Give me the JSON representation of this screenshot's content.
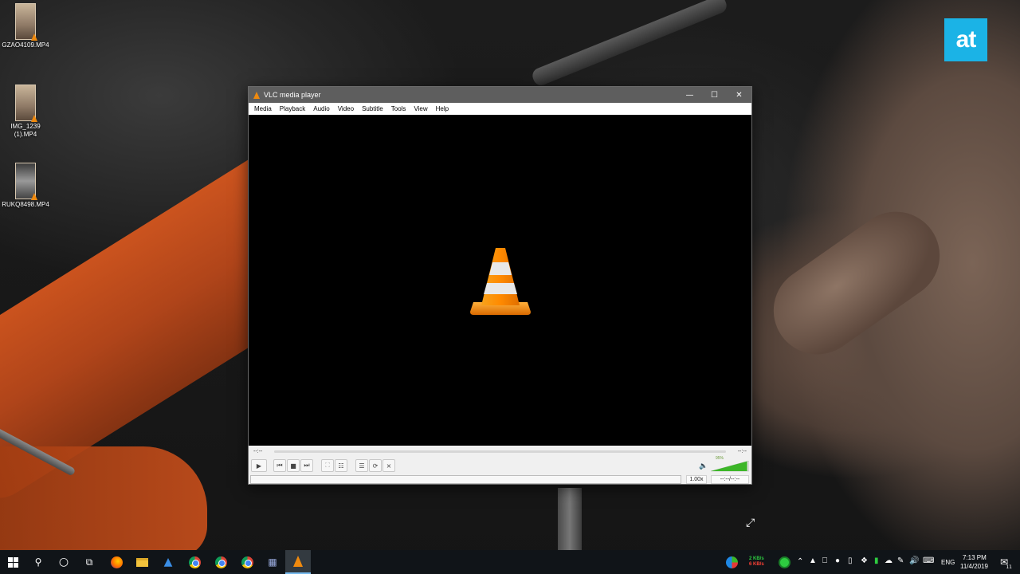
{
  "desktop": {
    "icons": [
      {
        "label": "GZAO4109.MP4"
      },
      {
        "label": "IMG_1239 (1).MP4"
      },
      {
        "label": "RUKQ8498.MP4"
      }
    ],
    "watermark": "at"
  },
  "vlc": {
    "title": "VLC media player",
    "menu": [
      "Media",
      "Playback",
      "Audio",
      "Video",
      "Subtitle",
      "Tools",
      "View",
      "Help"
    ],
    "elapsed": "--:--",
    "remaining": "--:--",
    "volume_percent": "95%",
    "volume_level": 0.95,
    "speed": "1.00x",
    "time_display": "--:--/--:--",
    "colors": {
      "cone_orange": "#f08a0e",
      "titlebar": "#5e5e5e",
      "volume_green": "#3cb628"
    }
  },
  "taskbar": {
    "net_up": "2 KB/s",
    "net_down": "6 KB/s",
    "language": "ENG",
    "time": "7:13 PM",
    "date": "11/4/2019",
    "notification_count": "11",
    "apps": [
      "start-icon",
      "search-icon",
      "cortana-icon",
      "task-view-icon",
      "firefox-icon",
      "file-explorer-icon",
      "app-icon",
      "chrome-icon",
      "chrome-icon",
      "chrome-icon",
      "app-icon",
      "vlc-icon"
    ]
  }
}
